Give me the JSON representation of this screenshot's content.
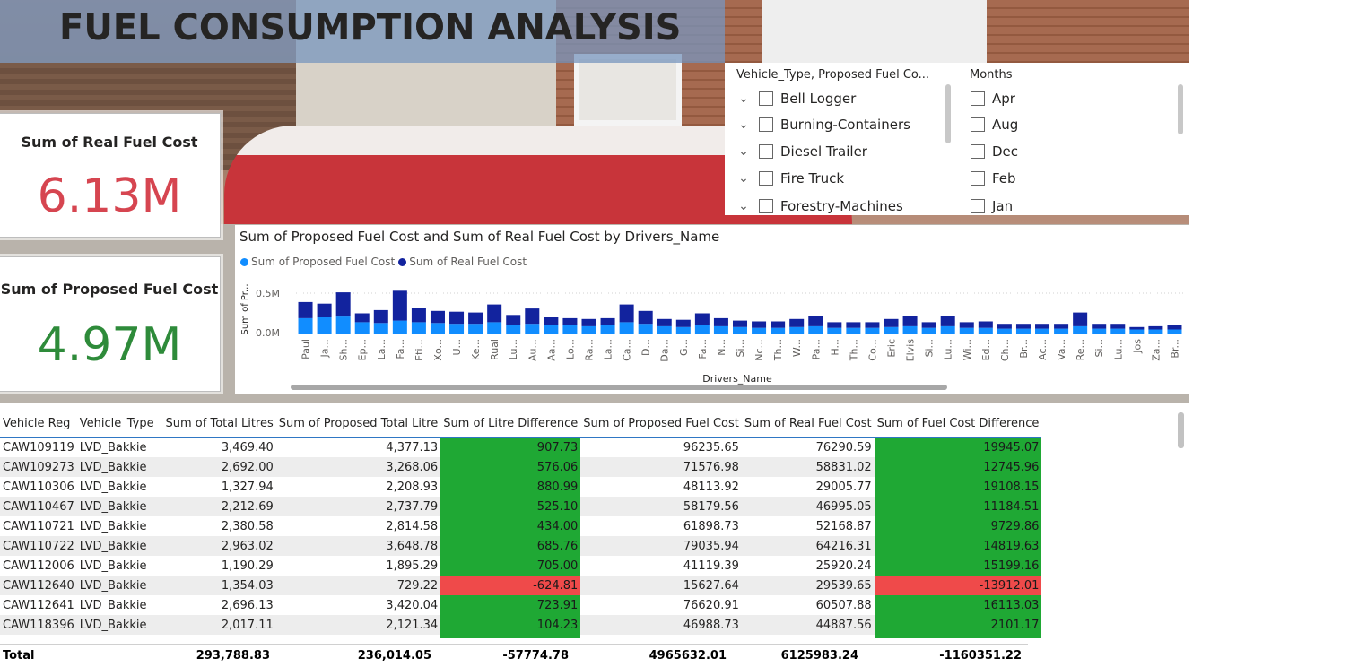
{
  "title": "FUEL CONSUMPTION ANALYSIS",
  "kpis": {
    "real_fuel_cost": {
      "label": "Sum of Real Fuel Cost",
      "value": "6.13M",
      "color": "#d64550"
    },
    "proposed_fuel_cost": {
      "label": "Sum of Proposed Fuel Cost",
      "value": "4.97M",
      "color": "#2e8b3a"
    }
  },
  "slicers": {
    "vehicle": {
      "header": "Vehicle_Type, Proposed Fuel Co...",
      "items": [
        "Bell Logger",
        "Burning-Containers",
        "Diesel Trailer",
        "Fire Truck",
        "Forestry-Machines"
      ]
    },
    "months": {
      "header": "Months",
      "items": [
        "Apr",
        "Aug",
        "Dec",
        "Feb",
        "Jan"
      ]
    }
  },
  "chart_data": {
    "type": "bar",
    "stacked": true,
    "title": "Sum of Proposed Fuel Cost and Sum of Real Fuel Cost by Drivers_Name",
    "xlabel": "Drivers_Name",
    "ylabel": "Sum of Pr...",
    "yticks": [
      "0.5M",
      "0.0M"
    ],
    "ylim": [
      0,
      0.6
    ],
    "series": [
      {
        "name": "Sum of Proposed Fuel Cost",
        "color": "#118dff"
      },
      {
        "name": "Sum of Real Fuel Cost",
        "color": "#12239e"
      }
    ],
    "categories": [
      "Paul",
      "Ja...",
      "Sh...",
      "Ep...",
      "La...",
      "Fa...",
      "Eti...",
      "Xo...",
      "U...",
      "Ke...",
      "Rual",
      "Lu...",
      "Au...",
      "Aa...",
      "Lo...",
      "Ra...",
      "La...",
      "Ca...",
      "D...",
      "Da...",
      "G...",
      "Fa...",
      "N...",
      "Si...",
      "Nc...",
      "Th...",
      "W...",
      "Pa...",
      "H...",
      "Th...",
      "Co...",
      "Eric",
      "Elvis",
      "Si...",
      "Lu...",
      "Wi...",
      "Ed...",
      "Ch...",
      "Br...",
      "Ac...",
      "Va...",
      "Re...",
      "Si...",
      "Lu...",
      "Jos",
      "Za...",
      "Br..."
    ],
    "proposed_values": [
      0.19,
      0.2,
      0.21,
      0.14,
      0.13,
      0.16,
      0.14,
      0.13,
      0.12,
      0.12,
      0.14,
      0.11,
      0.12,
      0.1,
      0.1,
      0.09,
      0.1,
      0.14,
      0.12,
      0.09,
      0.08,
      0.1,
      0.09,
      0.08,
      0.07,
      0.07,
      0.08,
      0.09,
      0.07,
      0.07,
      0.07,
      0.08,
      0.09,
      0.07,
      0.09,
      0.07,
      0.07,
      0.06,
      0.06,
      0.06,
      0.06,
      0.09,
      0.06,
      0.06,
      0.05,
      0.05,
      0.05
    ],
    "real_values": [
      0.2,
      0.17,
      0.3,
      0.11,
      0.16,
      0.37,
      0.18,
      0.15,
      0.15,
      0.14,
      0.22,
      0.12,
      0.19,
      0.1,
      0.09,
      0.09,
      0.09,
      0.22,
      0.16,
      0.09,
      0.09,
      0.15,
      0.1,
      0.08,
      0.08,
      0.08,
      0.1,
      0.13,
      0.07,
      0.07,
      0.07,
      0.1,
      0.13,
      0.07,
      0.13,
      0.07,
      0.08,
      0.06,
      0.06,
      0.06,
      0.06,
      0.17,
      0.06,
      0.06,
      0.03,
      0.04,
      0.05
    ]
  },
  "table": {
    "headers": [
      "Vehicle Reg",
      "Vehicle_Type",
      "Sum of Total Litres",
      "Sum of Proposed Total Litre",
      "Sum of Litre Difference",
      "Sum of Proposed Fuel Cost",
      "Sum of Real Fuel Cost",
      "Sum of Fuel Cost Difference"
    ],
    "rows": [
      [
        "CAW109119",
        "LVD_Bakkie",
        "3,469.40",
        "4,377.13",
        "907.73",
        "96235.65",
        "76290.59",
        "19945.07"
      ],
      [
        "CAW109273",
        "LVD_Bakkie",
        "2,692.00",
        "3,268.06",
        "576.06",
        "71576.98",
        "58831.02",
        "12745.96"
      ],
      [
        "CAW110306",
        "LVD_Bakkie",
        "1,327.94",
        "2,208.93",
        "880.99",
        "48113.92",
        "29005.77",
        "19108.15"
      ],
      [
        "CAW110467",
        "LVD_Bakkie",
        "2,212.69",
        "2,737.79",
        "525.10",
        "58179.56",
        "46995.05",
        "11184.51"
      ],
      [
        "CAW110721",
        "LVD_Bakkie",
        "2,380.58",
        "2,814.58",
        "434.00",
        "61898.73",
        "52168.87",
        "9729.86"
      ],
      [
        "CAW110722",
        "LVD_Bakkie",
        "2,963.02",
        "3,648.78",
        "685.76",
        "79035.94",
        "64216.31",
        "14819.63"
      ],
      [
        "CAW112006",
        "LVD_Bakkie",
        "1,190.29",
        "1,895.29",
        "705.00",
        "41119.39",
        "25920.24",
        "15199.16"
      ],
      [
        "CAW112640",
        "LVD_Bakkie",
        "1,354.03",
        "729.22",
        "-624.81",
        "15627.64",
        "29539.65",
        "-13912.01"
      ],
      [
        "CAW112641",
        "LVD_Bakkie",
        "2,696.13",
        "3,420.04",
        "723.91",
        "76620.91",
        "60507.88",
        "16113.03"
      ],
      [
        "CAW118396",
        "LVD_Bakkie",
        "2,017.11",
        "2,121.34",
        "104.23",
        "46988.73",
        "44887.56",
        "2101.17"
      ]
    ],
    "totals": [
      "Total",
      "293,788.83",
      "236,014.05",
      "-57774.78",
      "4965632.01",
      "6125983.24",
      "-1160351.22"
    ]
  }
}
